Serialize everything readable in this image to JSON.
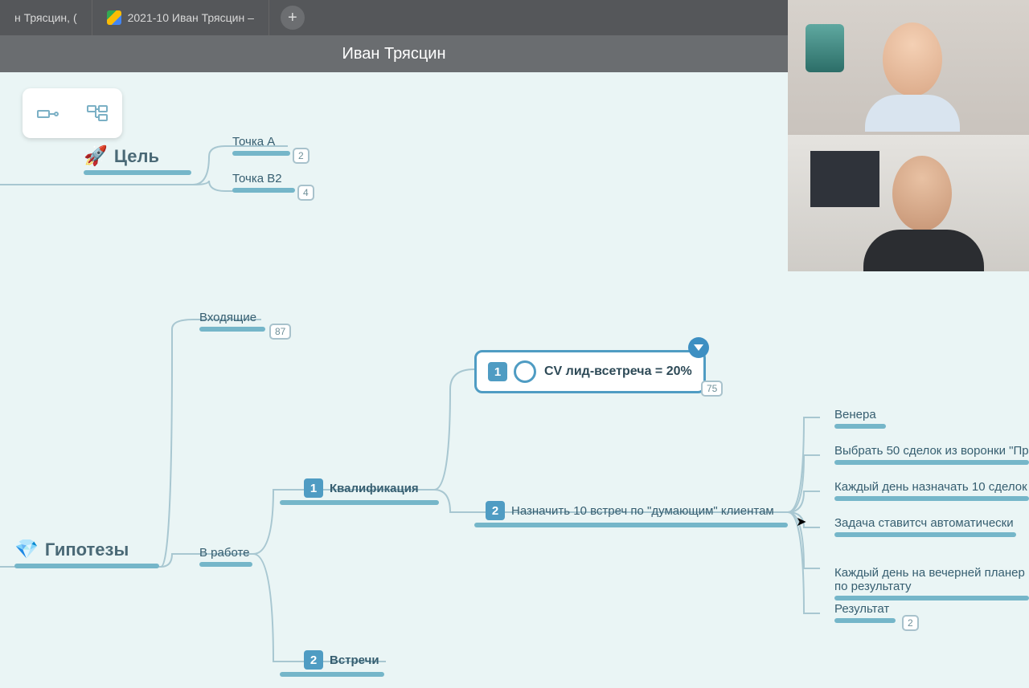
{
  "tabs": {
    "t0": "н Трясцин, (",
    "t1": "2021-10 Иван Трясцин –"
  },
  "title": "Иван Трясцин",
  "nodes": {
    "goal_root": "Цель",
    "point_a": "Точка А",
    "point_a_badge": "2",
    "point_b2": "Точка В2",
    "point_b2_badge": "4",
    "incoming": "Входящие",
    "incoming_badge": "87",
    "hypo_root": "Гипотезы",
    "inwork": "В работе",
    "qual_num": "1",
    "qual": "Квалификация",
    "cv_num": "1",
    "cv_text": "CV лид-всетреча = 20%",
    "cv_badge": "75",
    "assign_num": "2",
    "assign": "Назначить 10 встреч по \"думающим\" клиентам",
    "meet_num": "2",
    "meet": "Встречи",
    "venera": "Венера",
    "pick50": "Выбрать 50 сделок из воронки \"Пр",
    "daily10": "Каждый день назначать 10 сделок",
    "autotask": "Задача ставитсч автоматически",
    "evening": "Каждый день на вечерней планер\nпо результату",
    "result": "Результат",
    "result_badge": "2"
  }
}
